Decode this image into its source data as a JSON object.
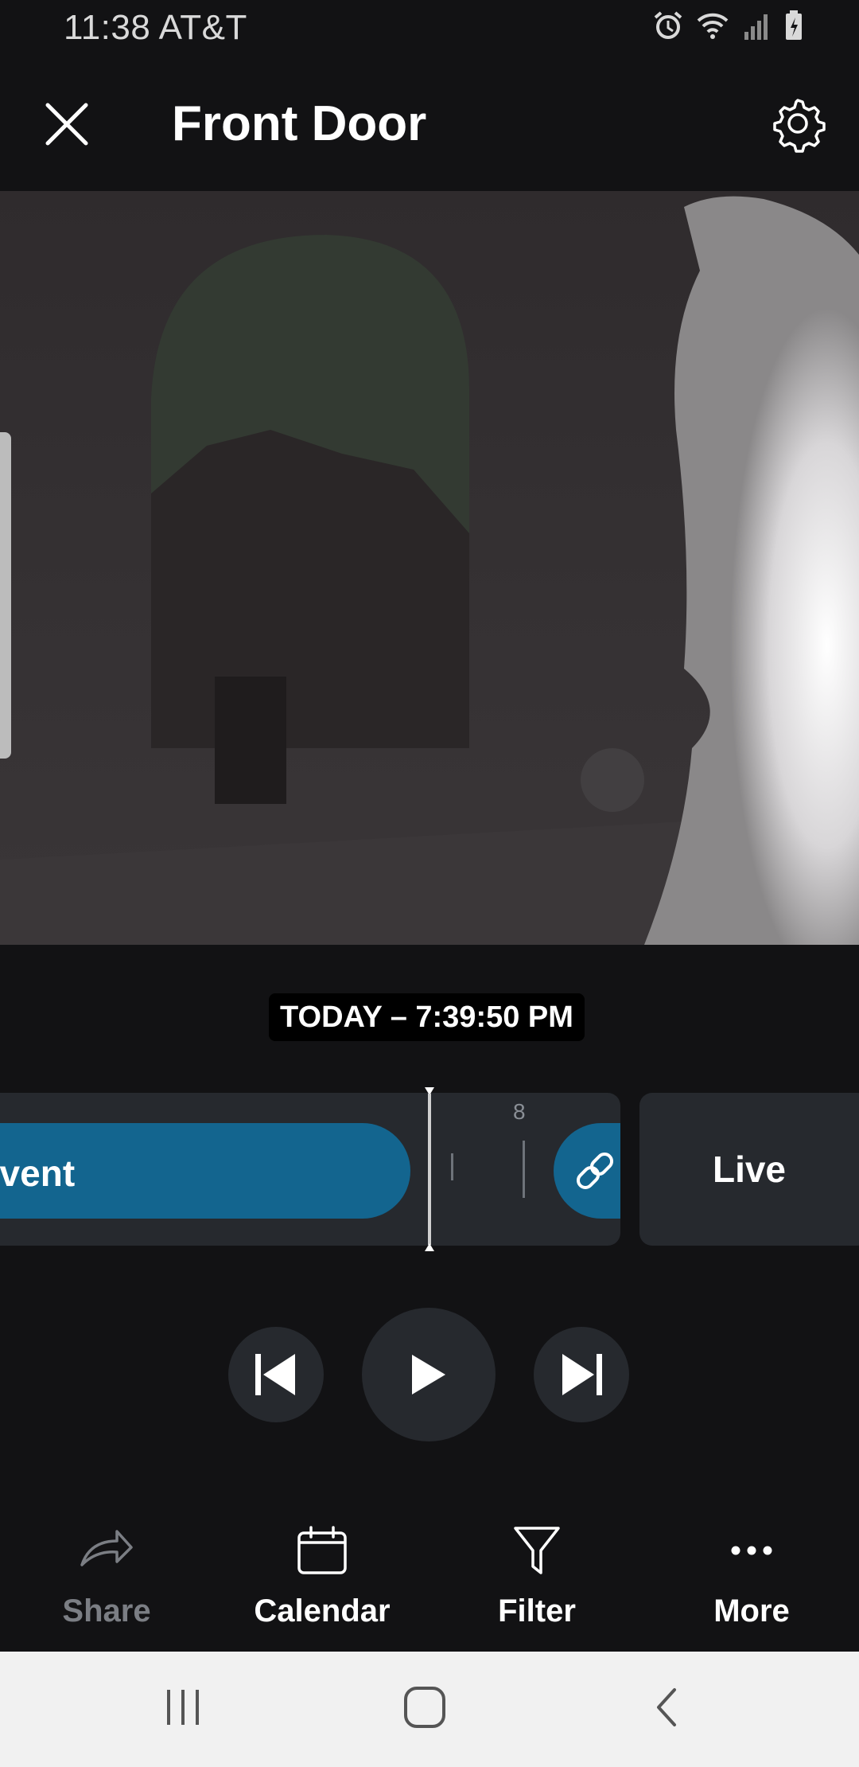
{
  "status_bar": {
    "time": "11:38 AT&T",
    "icons": [
      "alarm-icon",
      "wifi-icon",
      "signal-icon",
      "battery-icon"
    ]
  },
  "header": {
    "title": "Front Door",
    "close_icon": "close-icon",
    "settings_icon": "gear-icon"
  },
  "video": {
    "description_icon": "camera-feed"
  },
  "timestamp": "TODAY – 7:39:50 PM",
  "timeline": {
    "event_label": "d Event",
    "tick_label": "8",
    "link_icon": "link-icon",
    "live_label": "Live"
  },
  "controls": {
    "previous_icon": "skip-previous-icon",
    "play_icon": "play-icon",
    "next_icon": "skip-next-icon"
  },
  "toolbar": {
    "items": [
      {
        "label": "Share",
        "icon": "share-icon",
        "enabled": false
      },
      {
        "label": "Calendar",
        "icon": "calendar-icon",
        "enabled": true
      },
      {
        "label": "Filter",
        "icon": "filter-icon",
        "enabled": true
      },
      {
        "label": "More",
        "icon": "more-icon",
        "enabled": true
      }
    ]
  },
  "nav_bar": {
    "icons": [
      "recent-apps-icon",
      "home-icon",
      "back-icon"
    ]
  },
  "colors": {
    "background": "#121214",
    "panel": "#26292e",
    "accent": "#13658f",
    "disabled_text": "#7b7e84",
    "nav_bar": "#f1f1f1"
  }
}
